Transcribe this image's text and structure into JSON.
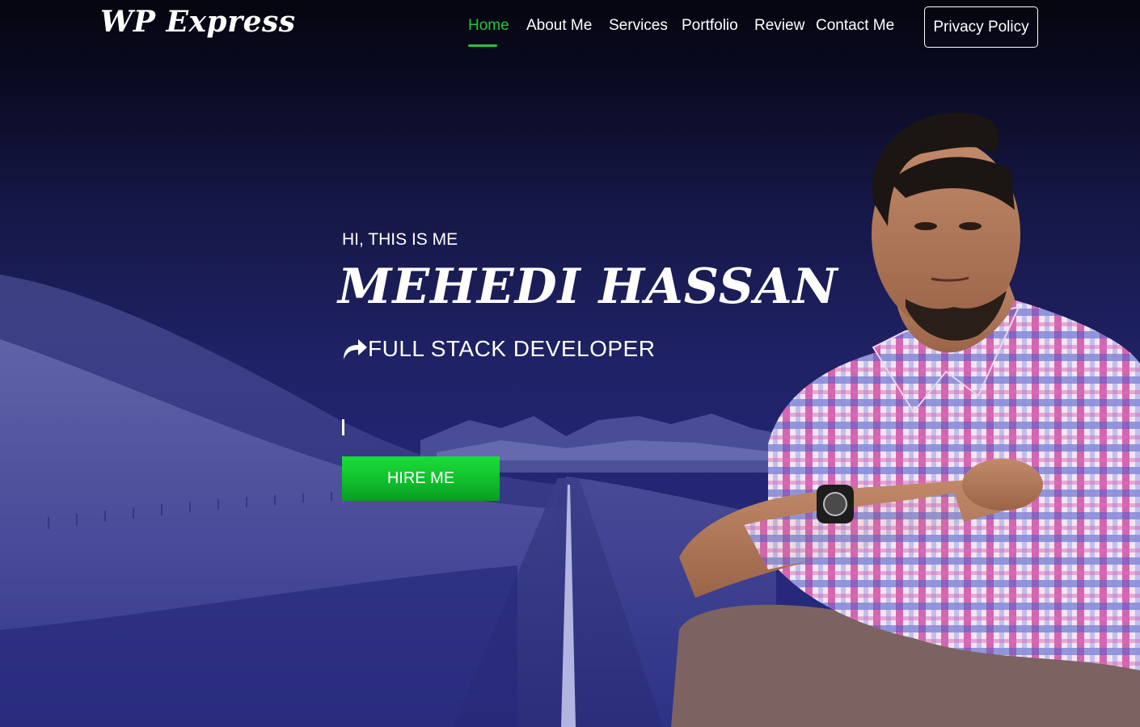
{
  "brand": {
    "logo_text": "WP Express"
  },
  "nav": {
    "items": [
      {
        "label": "Home",
        "active": true
      },
      {
        "label": "About Me",
        "active": false
      },
      {
        "label": "Services",
        "active": false
      },
      {
        "label": "Portfolio",
        "active": false
      },
      {
        "label": "Review",
        "active": false
      },
      {
        "label": "Contact Me",
        "active": false
      }
    ],
    "privacy_button": "Privacy Policy"
  },
  "hero": {
    "intro": "HI, THIS IS ME",
    "name": "MEHEDI HASSAN",
    "role": "FULL STACK DEVELOPER",
    "role_icon": "share-arrow-icon",
    "typed_text": "",
    "cta_label": "HIRE ME"
  },
  "colors": {
    "accent": "#1ec83c",
    "button_green": "#0fbf2c",
    "background_top": "#05050f",
    "background_bottom": "#272a7e"
  }
}
